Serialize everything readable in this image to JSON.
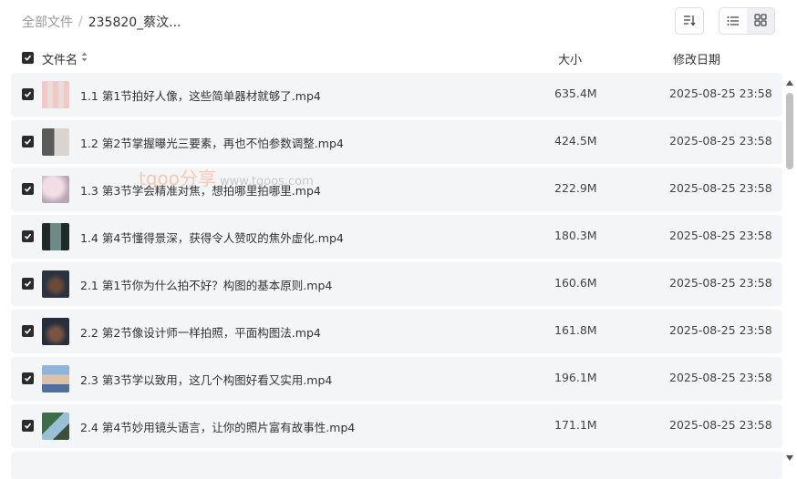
{
  "breadcrumb": {
    "root": "全部文件",
    "separator": "/",
    "current": "235820_蔡汶..."
  },
  "columns": {
    "name": "文件名",
    "size": "大小",
    "modified": "修改日期"
  },
  "watermark": {
    "brand": "tgoo分享",
    "url": "www.tgoos.com"
  },
  "files": [
    {
      "name": "1.1 第1节拍好人像，这些简单器材就够了.mp4",
      "size": "635.4M",
      "modified": "2025-08-25 23:58"
    },
    {
      "name": "1.2 第2节掌握曝光三要素，再也不怕参数调整.mp4",
      "size": "424.5M",
      "modified": "2025-08-25 23:58"
    },
    {
      "name": "1.3 第3节学会精准对焦，想拍哪里拍哪里.mp4",
      "size": "222.9M",
      "modified": "2025-08-25 23:58"
    },
    {
      "name": "1.4 第4节懂得景深，获得令人赞叹的焦外虚化.mp4",
      "size": "180.3M",
      "modified": "2025-08-25 23:58"
    },
    {
      "name": "2.1 第1节你为什么拍不好？构图的基本原则.mp4",
      "size": "160.6M",
      "modified": "2025-08-25 23:58"
    },
    {
      "name": "2.2 第2节像设计师一样拍照，平面构图法.mp4",
      "size": "161.8M",
      "modified": "2025-08-25 23:58"
    },
    {
      "name": "2.3 第3节学以致用，这几个构图好看又实用.mp4",
      "size": "196.1M",
      "modified": "2025-08-25 23:58"
    },
    {
      "name": "2.4 第4节妙用镜头语言，让你的照片富有故事性.mp4",
      "size": "171.1M",
      "modified": "2025-08-25 23:58"
    }
  ]
}
